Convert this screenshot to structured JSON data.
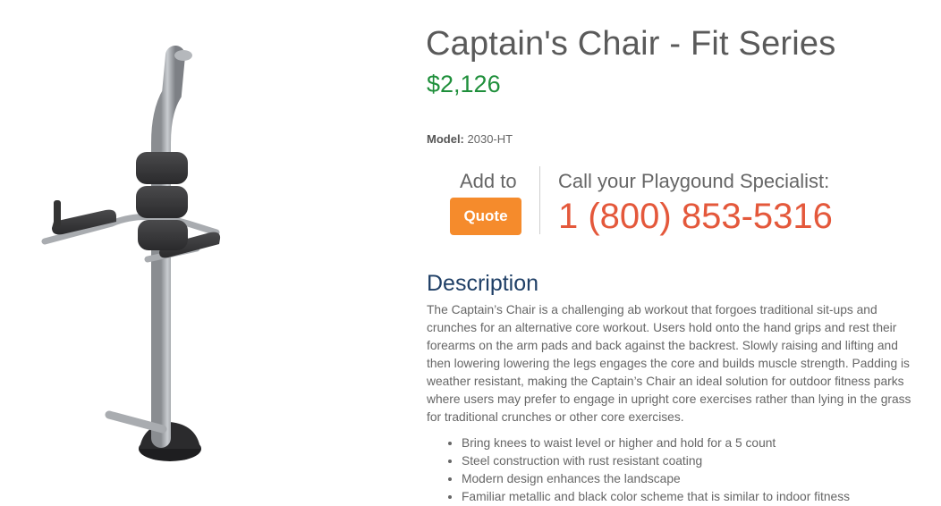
{
  "product": {
    "title": "Captain's Chair - Fit Series",
    "price": "$2,126",
    "model_label": "Model:",
    "model_value": "2030-HT",
    "image_icon": "captains-chair-product-image"
  },
  "quote": {
    "add_to_label": "Add to",
    "button_label": "Quote",
    "button_color": "#f58b2c"
  },
  "contact": {
    "call_label": "Call your Playgound Specialist:",
    "phone": "1 (800) 853-5316",
    "phone_color": "#e4583b"
  },
  "description": {
    "heading": "Description",
    "text": "The Captain’s Chair is a challenging ab workout that forgoes traditional sit-ups and crunches for an alternative core workout. Users hold onto the hand grips and rest their forearms on the arm pads and back against the backrest. Slowly raising and lifting and then lowering lowering the legs engages the core and builds muscle strength. Padding is weather resistant, making the Captain’s Chair an ideal solution for outdoor fitness parks where users may prefer to engage in upright core exercises rather than lying in the grass for traditional crunches or other core exercises.",
    "bullets": [
      "Bring knees to waist level or higher and hold for a 5 count",
      "Steel construction with rust resistant coating",
      "Modern design enhances the landscape",
      "Familiar metallic and black color scheme that is similar to indoor fitness"
    ]
  },
  "colors": {
    "price": "#1f8f3b",
    "heading": "#1f3f66"
  }
}
